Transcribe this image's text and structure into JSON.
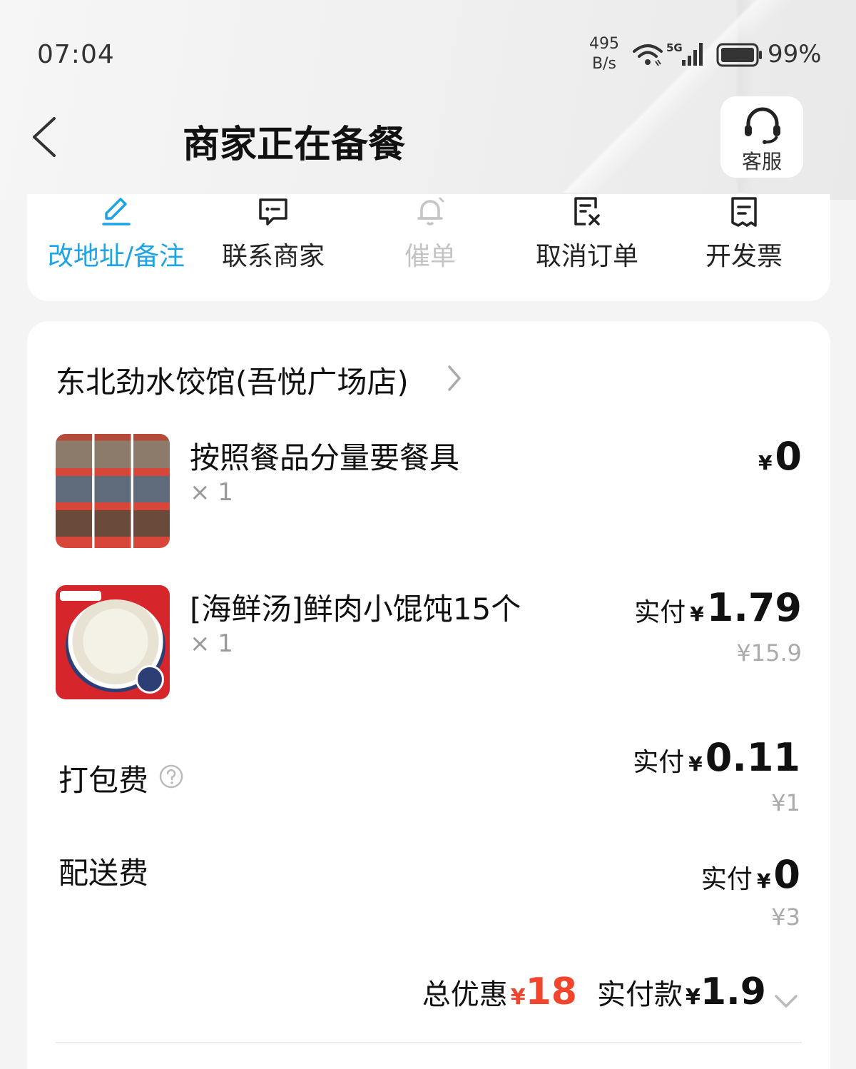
{
  "status_bar": {
    "time": "07:04",
    "net_speed_value": "495",
    "net_speed_unit": "B/s",
    "network": "5G",
    "battery": "99%"
  },
  "header": {
    "title": "商家正在备餐",
    "customer_service_label": "客服"
  },
  "actions": [
    {
      "label": "改地址/备注",
      "icon": "edit-icon",
      "color": "#1ba4e8"
    },
    {
      "label": "联系商家",
      "icon": "chat-icon"
    },
    {
      "label": "催单",
      "icon": "bell-icon",
      "disabled": true
    },
    {
      "label": "取消订单",
      "icon": "cancel-doc-icon"
    },
    {
      "label": "开发票",
      "icon": "invoice-icon"
    }
  ],
  "order": {
    "shop_name": "东北劲水饺馆(吾悦广场店)",
    "items": [
      {
        "name": "按照餐品分量要餐具",
        "qty": "× 1",
        "price_prefix": "",
        "currency": "¥",
        "price": "0",
        "original_price": ""
      },
      {
        "name": "[海鲜汤]鲜肉小馄饨15个",
        "qty": "× 1",
        "price_prefix": "实付",
        "currency": "¥",
        "price": "1.79",
        "original_price": "¥15.9"
      }
    ],
    "fees": [
      {
        "label": "打包费",
        "price_prefix": "实付",
        "currency": "¥",
        "price": "0.11",
        "original_price": "¥1"
      },
      {
        "label": "配送费",
        "price_prefix": "实付",
        "currency": "¥",
        "price": "0",
        "original_price": "¥3"
      }
    ],
    "summary": {
      "discount_label": "总优惠",
      "discount_currency": "¥",
      "discount_value": "18",
      "paid_label": "实付款",
      "paid_currency": "¥",
      "paid_value": "1.9"
    }
  },
  "colors": {
    "accent": "#1ba4e8",
    "discount_red": "#f1462d",
    "disabled": "#c4c4c4"
  }
}
